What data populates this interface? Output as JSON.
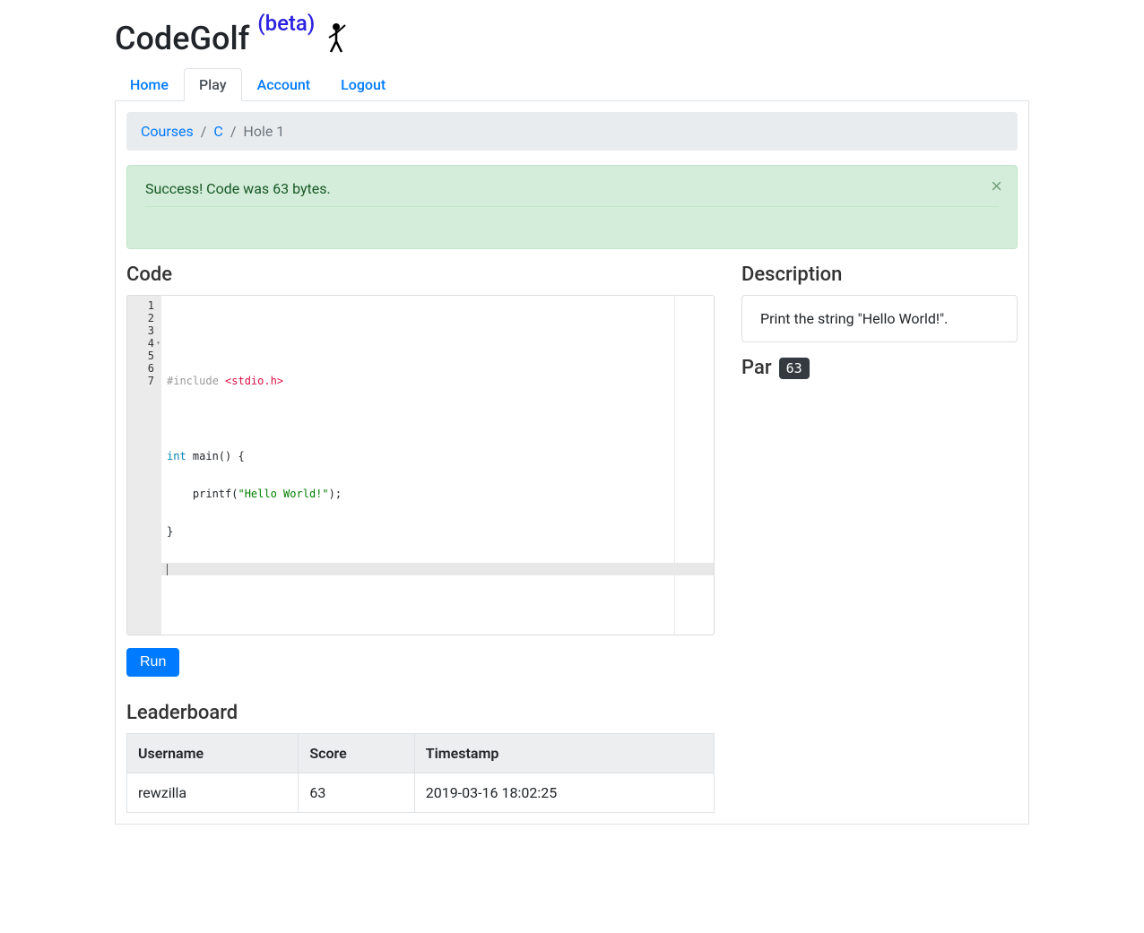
{
  "header": {
    "title_main": "CodeGolf",
    "title_beta": "(beta)"
  },
  "nav": {
    "tabs": [
      {
        "label": "Home",
        "active": false
      },
      {
        "label": "Play",
        "active": true
      },
      {
        "label": "Account",
        "active": false
      },
      {
        "label": "Logout",
        "active": false
      }
    ]
  },
  "breadcrumb": {
    "items": [
      {
        "label": "Courses",
        "link": true
      },
      {
        "label": "C",
        "link": true
      },
      {
        "label": "Hole 1",
        "link": false
      }
    ]
  },
  "alert": {
    "message": "Success! Code was 63 bytes."
  },
  "code": {
    "heading": "Code",
    "lines": [
      "",
      "#include <stdio.h>",
      "",
      "int main() {",
      "    printf(\"Hello World!\");",
      "}",
      ""
    ],
    "run_label": "Run"
  },
  "description": {
    "heading": "Description",
    "text": "Print the string \"Hello World!\"."
  },
  "par": {
    "label": "Par",
    "value": "63"
  },
  "leaderboard": {
    "heading": "Leaderboard",
    "columns": [
      "Username",
      "Score",
      "Timestamp"
    ],
    "rows": [
      {
        "username": "rewzilla",
        "score": "63",
        "timestamp": "2019-03-16 18:02:25"
      }
    ]
  }
}
